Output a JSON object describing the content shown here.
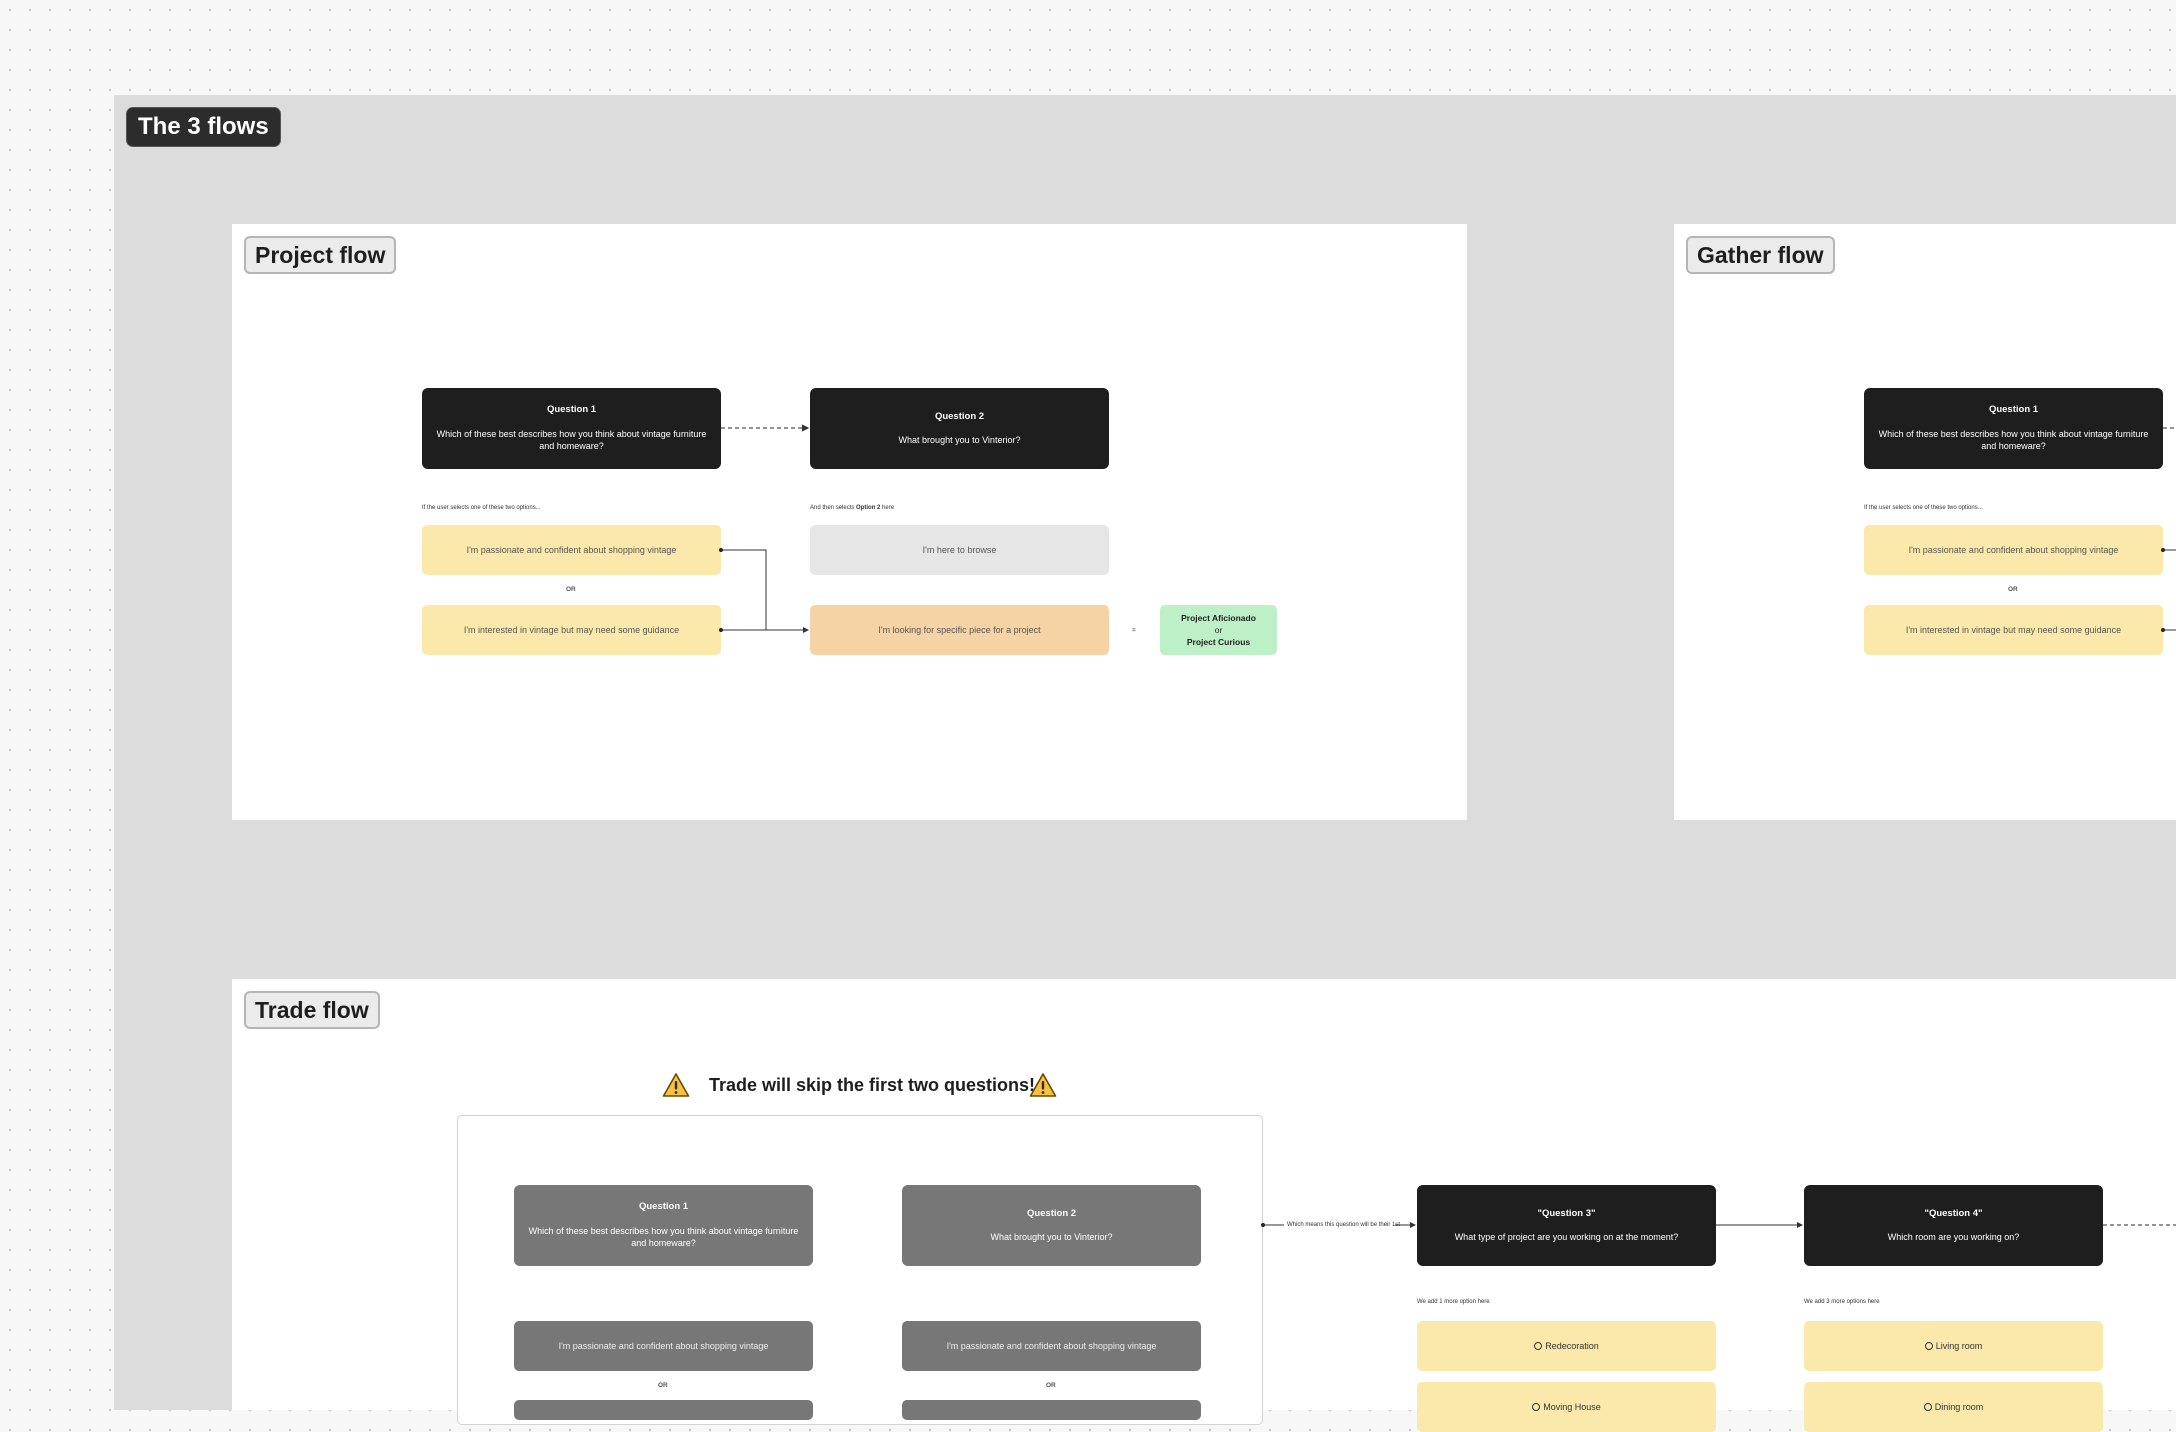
{
  "board": {
    "title": "The 3 flows"
  },
  "project_flow": {
    "title": "Project flow",
    "q1": {
      "title": "Question 1",
      "text": "Which of these best describes how you think about vintage furniture and homeware?"
    },
    "q2": {
      "title": "Question 2",
      "text": "What brought you to Vinterior?"
    },
    "note_q1": "If the user selects one of these two options...",
    "note_q2_pre": "And then selects ",
    "note_q2_bold": "Option 2",
    "note_q2_post": " here",
    "opt1": "I'm passionate and confident about shopping vintage",
    "or": "OR",
    "opt2": "I'm interested in vintage but may need some guidance",
    "opt_browse": "I'm here to browse",
    "opt_project": "I'm looking for specific piece for a project",
    "equals": "=",
    "result_line1": "Project Aficionado",
    "result_or": "or",
    "result_line2": "Project Curious"
  },
  "gather_flow": {
    "title": "Gather flow",
    "q1": {
      "title": "Question 1",
      "text": "Which of these best describes how you think about vintage furniture and homeware?"
    },
    "note_q1": "If the user selects one of these two options...",
    "opt1": "I'm passionate and confident about shopping vintage",
    "or": "OR",
    "opt2": "I'm interested in vintage but may need some guidance"
  },
  "trade_flow": {
    "title": "Trade flow",
    "warning": "Trade will skip the first two questions!",
    "warning_icon": "warning-triangle-icon",
    "q1": {
      "title": "Question 1",
      "text": "Which of these best describes how you think about vintage furniture and homeware?"
    },
    "q2": {
      "title": "Question 2",
      "text": "What brought you to Vinterior?"
    },
    "opt_a": "I'm passionate and confident about shopping vintage",
    "opt_b": "I'm passionate and confident about shopping vintage",
    "or_a": "OR",
    "or_b": "OR",
    "connector_note": "Which means this question will be their 1st",
    "q3": {
      "title": "\"Question 3\"",
      "text": "What type of project are you working on at the moment?"
    },
    "q4": {
      "title": "\"Question 4\"",
      "text": "Which room are you working on?"
    },
    "note_q3": "We add 1 more option here",
    "note_q4": "We add 3 more options here",
    "q3_options": [
      "Redecoration",
      "Moving House"
    ],
    "q4_options": [
      "Living room",
      "Dining room"
    ]
  },
  "colors": {
    "question_card": "#1e1e1e",
    "option_yellow": "#fbe9ab",
    "option_orange": "#f6d3a5",
    "option_grey": "#e6e6e6",
    "result_green": "#bdf0c6",
    "section_bg": "#dcdcdc"
  }
}
